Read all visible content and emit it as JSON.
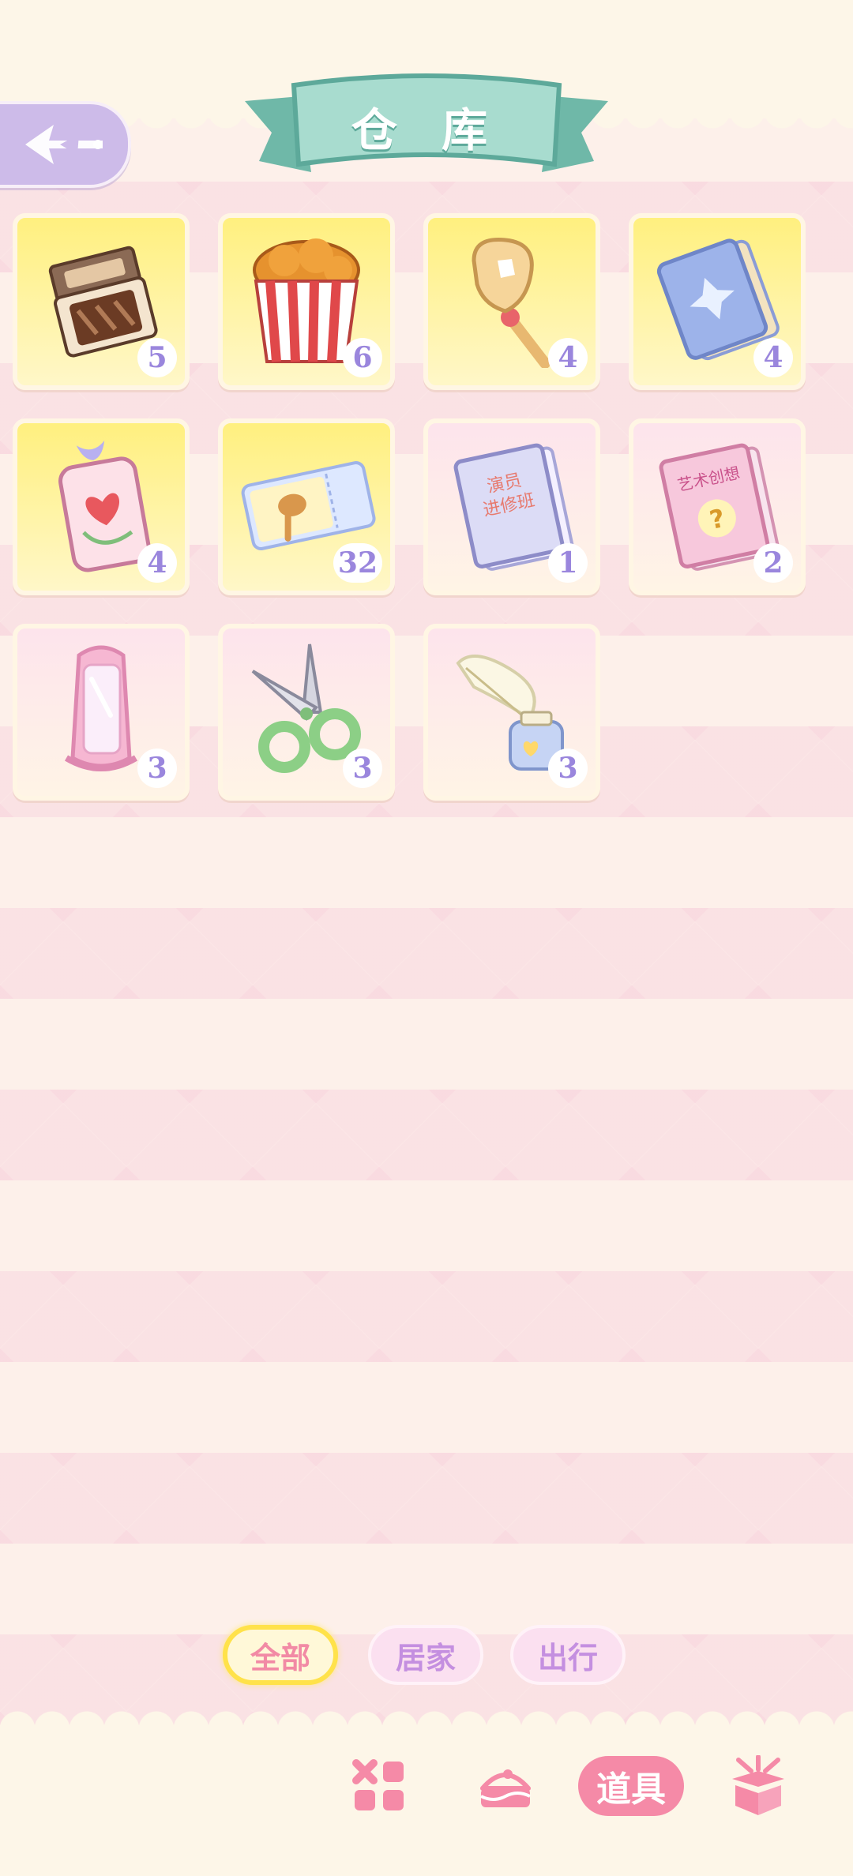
{
  "header": {
    "title": "仓 库",
    "back_icon": "back-arrow-icon"
  },
  "colors": {
    "accent_pink": "#f58aa7",
    "count_purple": "#9a86dd",
    "banner_teal": "#8fcfbf",
    "active_tab_border": "#ffe24a"
  },
  "inventory": {
    "items": [
      {
        "icon": "chocolate-box-icon",
        "count": "5",
        "rarity": "yellow"
      },
      {
        "icon": "fried-chicken-bucket-icon",
        "count": "6",
        "rarity": "yellow"
      },
      {
        "icon": "cookie-wand-icon",
        "count": "4",
        "rarity": "yellow"
      },
      {
        "icon": "blue-book-icon",
        "count": "4",
        "rarity": "yellow"
      },
      {
        "icon": "heart-charm-bag-icon",
        "count": "4",
        "rarity": "yellow"
      },
      {
        "icon": "ticket-icon",
        "count": "32",
        "rarity": "yellow"
      },
      {
        "icon": "acting-book-icon",
        "count": "1",
        "rarity": "pink",
        "cover_text": "演员\n进修班"
      },
      {
        "icon": "art-book-icon",
        "count": "2",
        "rarity": "pink",
        "cover_text": "艺术创想"
      },
      {
        "icon": "hand-mirror-icon",
        "count": "3",
        "rarity": "pink"
      },
      {
        "icon": "scissors-icon",
        "count": "3",
        "rarity": "pink"
      },
      {
        "icon": "quill-inkwell-icon",
        "count": "3",
        "rarity": "pink"
      }
    ]
  },
  "filter_tabs": [
    {
      "label": "全部",
      "active": true
    },
    {
      "label": "居家",
      "active": false
    },
    {
      "label": "出行",
      "active": false
    }
  ],
  "bottom_nav": [
    {
      "icon": "grid-icon",
      "label": ""
    },
    {
      "icon": "cake-icon",
      "label": ""
    },
    {
      "icon": "",
      "label": "道具",
      "active": true
    },
    {
      "icon": "gift-box-icon",
      "label": ""
    }
  ]
}
